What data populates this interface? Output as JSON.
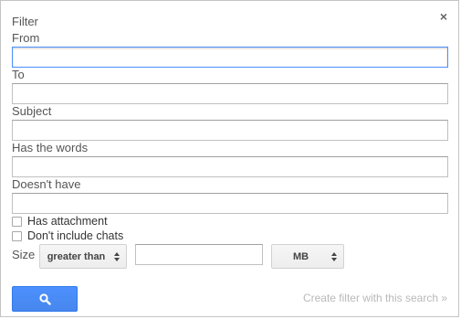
{
  "dialog": {
    "title": "Filter",
    "close_glyph": "×"
  },
  "fields": {
    "from_label": "From",
    "to_label": "To",
    "subject_label": "Subject",
    "has_words_label": "Has the words",
    "doesnt_have_label": "Doesn't have",
    "from_value": "",
    "to_value": "",
    "subject_value": "",
    "has_words_value": "",
    "doesnt_have_value": ""
  },
  "options": {
    "has_attachment_label": "Has attachment",
    "no_chats_label": "Don't include chats"
  },
  "size": {
    "label": "Size",
    "comparator": "greater than",
    "value": "",
    "unit": "MB"
  },
  "actions": {
    "search_icon": "search-icon",
    "create_filter_label": "Create filter with this search »"
  },
  "colors": {
    "accent": "#4d90fe",
    "link_disabled": "#b9b9b9"
  }
}
